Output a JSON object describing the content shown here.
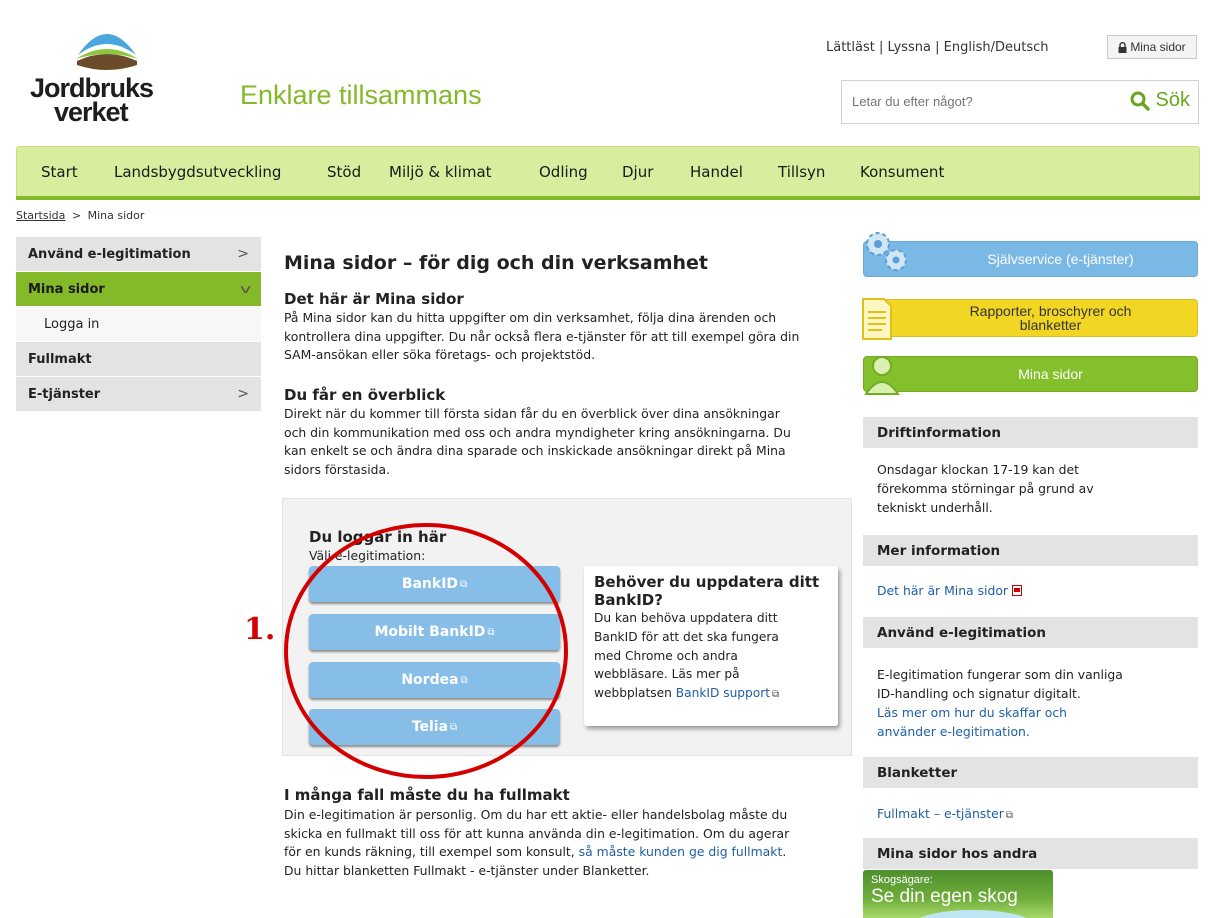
{
  "header": {
    "logo_line1": "Jordbruks",
    "logo_line2": "verket",
    "slogan": "Enklare tillsammans",
    "top_links": [
      "Lättläst",
      "Lyssna",
      "English/Deutsch"
    ],
    "mina_sidor_button": "Mina sidor",
    "search_placeholder": "Letar du efter något?",
    "search_button": "Sök"
  },
  "nav": [
    "Start",
    "Landsbygdsutveckling",
    "Stöd",
    "Miljö & klimat",
    "Odling",
    "Djur",
    "Handel",
    "Tillsyn",
    "Konsument"
  ],
  "breadcrumb": {
    "home": "Startsida",
    "sep": ">",
    "current": "Mina sidor"
  },
  "sidebar": [
    {
      "label": "Använd e-legitimation",
      "chevron": ">"
    },
    {
      "label": "Mina sidor",
      "chevron": "v"
    },
    {
      "label": "Logga in"
    },
    {
      "label": "Fullmakt"
    },
    {
      "label": "E-tjänster",
      "chevron": ">"
    }
  ],
  "main": {
    "title": "Mina sidor – för dig och din verksamhet",
    "section1_title": "Det här är Mina sidor",
    "section1_lines": [
      "På Mina sidor kan du hitta uppgifter om din verksamhet, följa dina ärenden och",
      "kontrollera dina uppgifter. Du når också flera e-tjänster för att till exempel göra din",
      "SAM-ansökan eller söka företags- och projektstöd."
    ],
    "section2_title": "Du får en överblick",
    "section2_lines": [
      "Direkt när du kommer till första sidan får du en överblick över dina ansökningar",
      "och din kommunikation med oss och andra myndigheter kring ansökningarna. Du",
      "kan enkelt se och ändra dina sparade och inskickade ansökningar direkt på Mina",
      "sidors förstasida."
    ],
    "login_title": "Du loggar in här",
    "login_sub": "Välj e-legitimation:",
    "login_buttons": [
      "BankID",
      "Mobilt BankID",
      "Nordea",
      "Telia"
    ],
    "annotation": "1.",
    "card_title_1": "Behöver du uppdatera ditt",
    "card_title_2": "BankID?",
    "card_lines": [
      "Du kan behöva uppdatera ditt",
      "BankID för att det ska fungera",
      "med Chrome och andra",
      "webbläsare. Läs mer på"
    ],
    "card_link_prefix": "webbplatsen",
    "card_link": "BankID support",
    "section3_title": "I många fall måste du ha fullmakt",
    "section3_lines": [
      "Din e-legitimation är personlig. Om du har ett aktie- eller handelsbolag måste du",
      "skicka en fullmakt till oss för att kunna använda din e-legitimation. Om du agerar"
    ],
    "section3_line3_prefix": "för en kunds räkning, till exempel som konsult,",
    "section3_line3_link": "så måste kunden ge dig fullmakt",
    "section3_line3_suffix": ".",
    "section3_line4": "Du hittar blanketten Fullmakt - e-tjänster under Blanketter."
  },
  "right": {
    "btn_selfservice": "Självservice (e-tjänster)",
    "btn_reports_1": "Rapporter, broschyrer och",
    "btn_reports_2": "blanketter",
    "btn_mina": "Mina sidor",
    "drift_title": "Driftinformation",
    "drift_lines": [
      "Onsdagar klockan 17-19 kan det",
      "förekomma störningar på grund av",
      "tekniskt underhåll."
    ],
    "mer_title": "Mer information",
    "mer_link": "Det här är Mina sidor",
    "anvand_title": "Använd e-legitimation",
    "anvand_lines": [
      "E-legitimation fungerar som din vanliga",
      "ID-handling och signatur digitalt."
    ],
    "anvand_link_1": "Läs mer om hur du skaffar och",
    "anvand_link_2": "använder e-legitimation.",
    "blanketter_title": "Blanketter",
    "blanketter_link": "Fullmakt – e-tjänster",
    "andra_title": "Mina sidor hos andra",
    "banner_small": "Skogsägare:",
    "banner_big": "Se din egen skog"
  },
  "colors": {
    "brand_green": "#84b92a",
    "nav_bg": "#d7ee9e",
    "login_blue": "#86bee8",
    "annotation_red": "#d40000"
  }
}
